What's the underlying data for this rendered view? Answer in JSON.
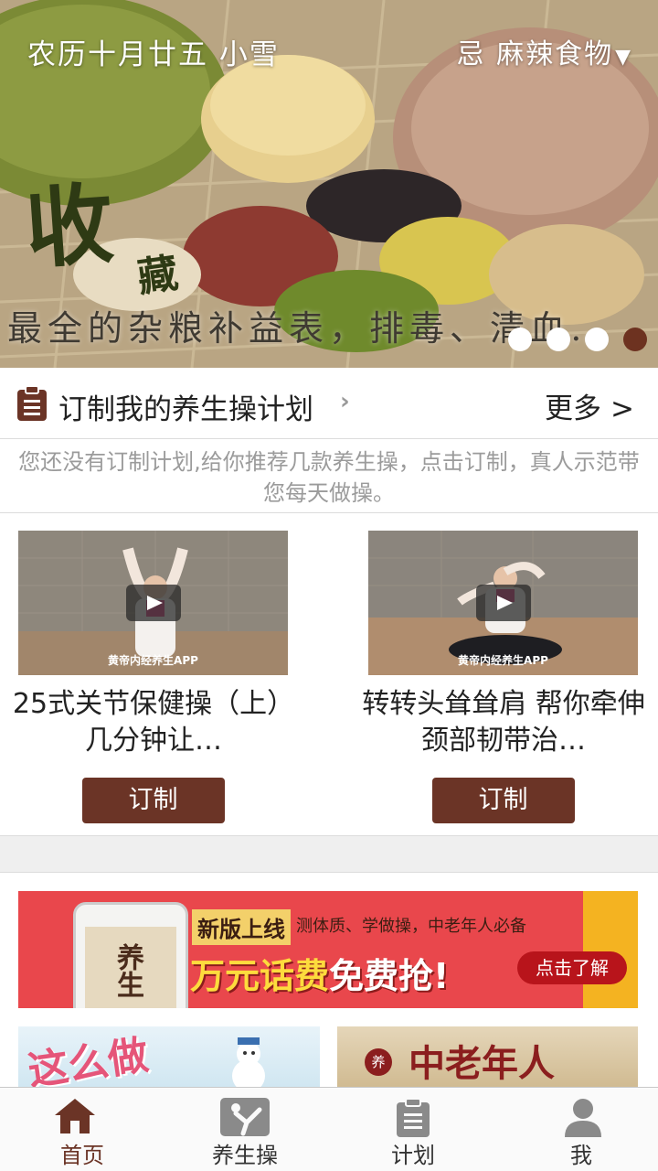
{
  "hero": {
    "lunar_date": "农历十月廿五  小雪",
    "taboo_label": "忌 麻辣食物",
    "taboo_arrow": "▼",
    "headline_big": "收",
    "headline_small": "藏",
    "caption": "最全的杂粮补益表，排毒、清血、养心…",
    "page_count": 4,
    "active_page": 4
  },
  "plan": {
    "title": "订制我的养生操计划",
    "chevron": "›",
    "more_label": "更多",
    "more_arrow": ">",
    "hint": "您还没有订制计划,给你推荐几款养生操，点击订制，真人示范带您每天做操。"
  },
  "videos": [
    {
      "title": "25式关节保健操（上） 几分钟让…",
      "watermark": "黄帝内经养生APP",
      "button": "订制"
    },
    {
      "title": "转转头耸耸肩 帮你牵伸颈部韧带治…",
      "watermark": "黄帝内经养生APP",
      "button": "订制"
    }
  ],
  "promo": {
    "phone_text": "养生",
    "tag": "新版上线",
    "subtitle": "测体质、学做操，中老年人必备",
    "main_a": "万元话费",
    "main_b": "免费抢!",
    "button": "点击了解"
  },
  "bottom_cards": [
    {
      "text": "这么做"
    },
    {
      "seal": "养",
      "text": "中老年人"
    }
  ],
  "tabbar": {
    "items": [
      {
        "label": "首页",
        "icon": "home-icon",
        "active": true
      },
      {
        "label": "养生操",
        "icon": "exercise-icon",
        "active": false
      },
      {
        "label": "计划",
        "icon": "clipboard-icon",
        "active": false
      },
      {
        "label": "我",
        "icon": "user-icon",
        "active": false
      }
    ]
  },
  "colors": {
    "brand": "#6b3426",
    "active_dot": "#6d3220",
    "hint_text": "#9b9b9b",
    "promo_red": "#e9474c"
  }
}
